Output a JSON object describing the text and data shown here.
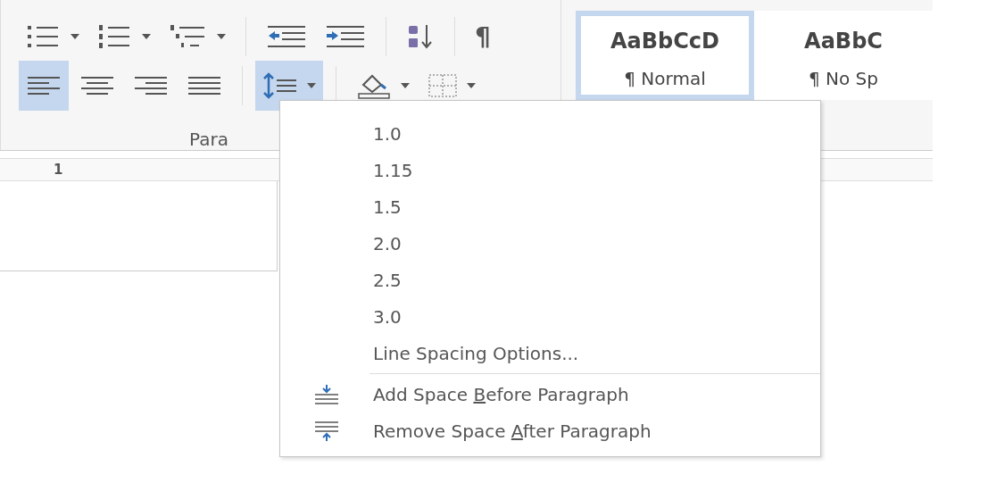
{
  "paragraph_group": {
    "label": "Para",
    "tools_row_1": [
      {
        "kind": "bullets",
        "dropdown": true
      },
      {
        "kind": "numbering",
        "dropdown": true
      },
      {
        "kind": "multilevel",
        "dropdown": true
      },
      {
        "kind": "outdent"
      },
      {
        "kind": "indent"
      },
      {
        "kind": "sort"
      },
      {
        "kind": "pilcrow",
        "glyph": "¶"
      }
    ],
    "tools_row_2": [
      {
        "kind": "align_left",
        "selected": true
      },
      {
        "kind": "align_center",
        "selected": false
      },
      {
        "kind": "align_right",
        "selected": false
      },
      {
        "kind": "justify",
        "selected": false
      },
      {
        "kind": "line_spacing",
        "dropdown": true,
        "selected": true
      },
      {
        "kind": "shading",
        "dropdown": true,
        "selected": false
      },
      {
        "kind": "borders",
        "dropdown": true,
        "selected": false
      }
    ]
  },
  "styles_gallery": [
    {
      "sample": "AaBbCcD",
      "name": "¶ Normal",
      "selected": true
    },
    {
      "sample": "AaBbC",
      "name": "¶ No Sp",
      "selected": false
    }
  ],
  "ruler": {
    "label": "1"
  },
  "line_spacing_menu": {
    "items": [
      {
        "kind": "value",
        "label": "1.0"
      },
      {
        "kind": "value",
        "label": "1.15"
      },
      {
        "kind": "value",
        "label": "1.5"
      },
      {
        "kind": "value",
        "label": "2.0"
      },
      {
        "kind": "value",
        "label": "2.5"
      },
      {
        "kind": "value",
        "label": "3.0"
      },
      {
        "kind": "options",
        "label": "Line Spacing Options..."
      },
      {
        "kind": "add_before",
        "before": "Add Space ",
        "key": "B",
        "after": "efore Paragraph"
      },
      {
        "kind": "remove_after",
        "before": "Remove Space ",
        "key": "A",
        "after": "fter Paragraph"
      }
    ]
  }
}
